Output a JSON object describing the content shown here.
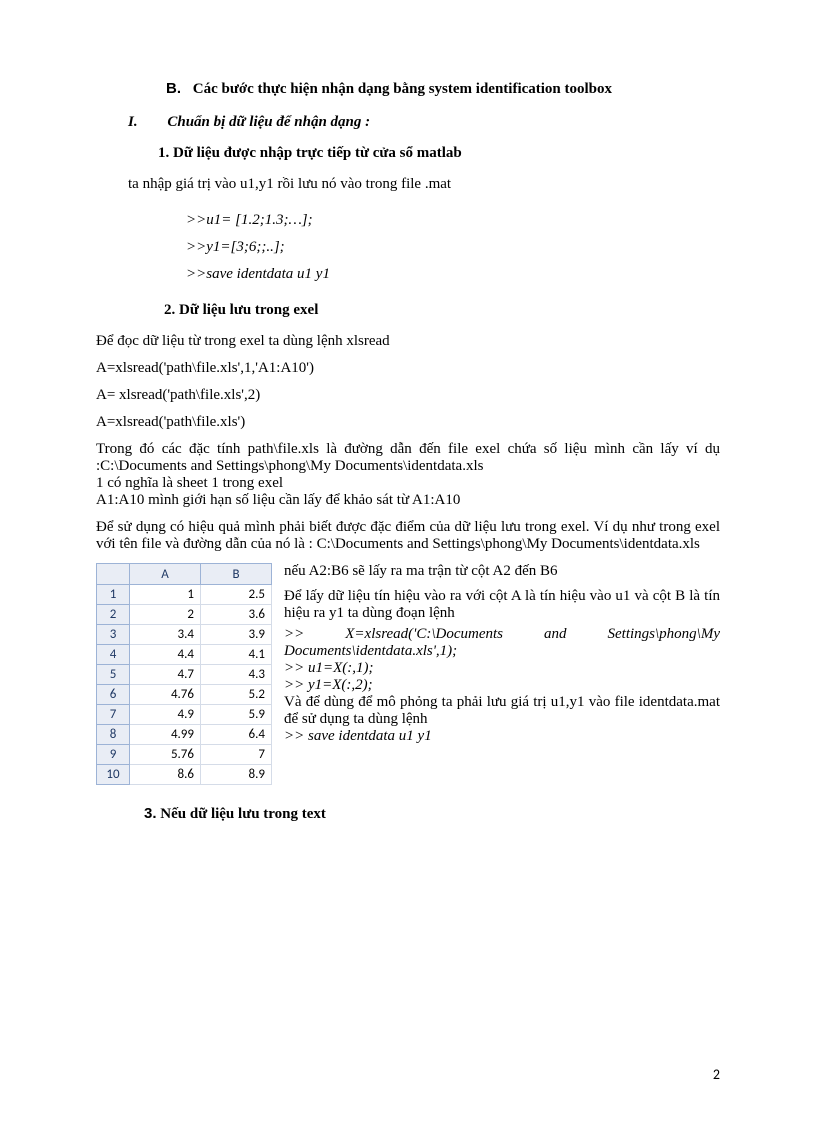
{
  "headings": {
    "b_marker": "B.",
    "b_text": "Các bước thực hiện nhận dạng bằng system identification toolbox",
    "i_marker": "I.",
    "i_text": "Chuẩn bị dữ liệu để nhận dạng :",
    "h1_marker": "1.",
    "h1_text": "Dữ liệu được nhập trực tiếp từ cửa sổ matlab",
    "h2_marker": "2.",
    "h2_text": "Dữ liệu lưu trong exel",
    "h3_marker": "3.",
    "h3_text": "Nếu dữ liệu lưu trong text"
  },
  "para": {
    "p1": "ta nhập giá trị vào u1,y1 rồi lưu nó vào trong file .mat",
    "code1a": ">>u1= [1.2;1.3;…];",
    "code1b": ">>y1=[3;6;;..];",
    "code1c": ">>save identdata u1 y1",
    "p2": "Để đọc dữ  liệu từ trong exel ta dùng lệnh xlsread",
    "p3": " A=xlsread('path\\file.xls',1,'A1:A10')",
    "p4": "A= xlsread('path\\file.xls',2)",
    "p5": "A=xlsread('path\\file.xls')",
    "p6": "Trong đó các đặc tính path\\file.xls là đường dẫn đến file exel chứa số liệu mình cần lấy ví dụ :C:\\Documents and Settings\\phong\\My Documents\\identdata.xls",
    "p6b": "1 có nghĩa là sheet 1 trong exel",
    "p6c": "A1:A10  mình giới hạn số liệu cần lấy để khảo sát từ A1:A10",
    "p7": "Để sử dụng có hiệu quả mình phải biết được đặc điểm của dữ liệu lưu trong exel. Ví dụ như trong exel với tên file và đường dẫn của nó là : C:\\Documents and Settings\\phong\\My Documents\\identdata.xls",
    "r1": "nếu A2:B6 sẽ lấy ra ma trận từ cột A2 đến B6",
    "r2": "Để lấy dữ liệu tín hiệu vào ra với cột A là tín hiệu vào u1 và cột B là tín hiệu ra y1 ta dùng đoạn lệnh",
    "r3_pre": ">>",
    "r3_mid": "X=xlsread('C:\\Documents",
    "r3_and": "and",
    "r3_end": "Settings\\phong\\My",
    "r3b": "Documents\\identdata.xls',1);",
    "r4": ">> u1=X(:,1);",
    "r5": ">> y1=X(:,2);",
    "r6": "Và để dùng để mô phỏng ta phải lưu giá trị u1,y1 vào file identdata.mat  để sử dụng ta dùng lệnh",
    "r7": " >> save identdata u1 y1"
  },
  "chart_data": {
    "type": "table",
    "columns": [
      "A",
      "B"
    ],
    "rows": [
      {
        "n": "1",
        "a": "1",
        "b": "2.5"
      },
      {
        "n": "2",
        "a": "2",
        "b": "3.6"
      },
      {
        "n": "3",
        "a": "3.4",
        "b": "3.9"
      },
      {
        "n": "4",
        "a": "4.4",
        "b": "4.1"
      },
      {
        "n": "5",
        "a": "4.7",
        "b": "4.3"
      },
      {
        "n": "6",
        "a": "4.76",
        "b": "5.2"
      },
      {
        "n": "7",
        "a": "4.9",
        "b": "5.9"
      },
      {
        "n": "8",
        "a": "4.99",
        "b": "6.4"
      },
      {
        "n": "9",
        "a": "5.76",
        "b": "7"
      },
      {
        "n": "10",
        "a": "8.6",
        "b": "8.9"
      }
    ]
  },
  "page_number": "2"
}
